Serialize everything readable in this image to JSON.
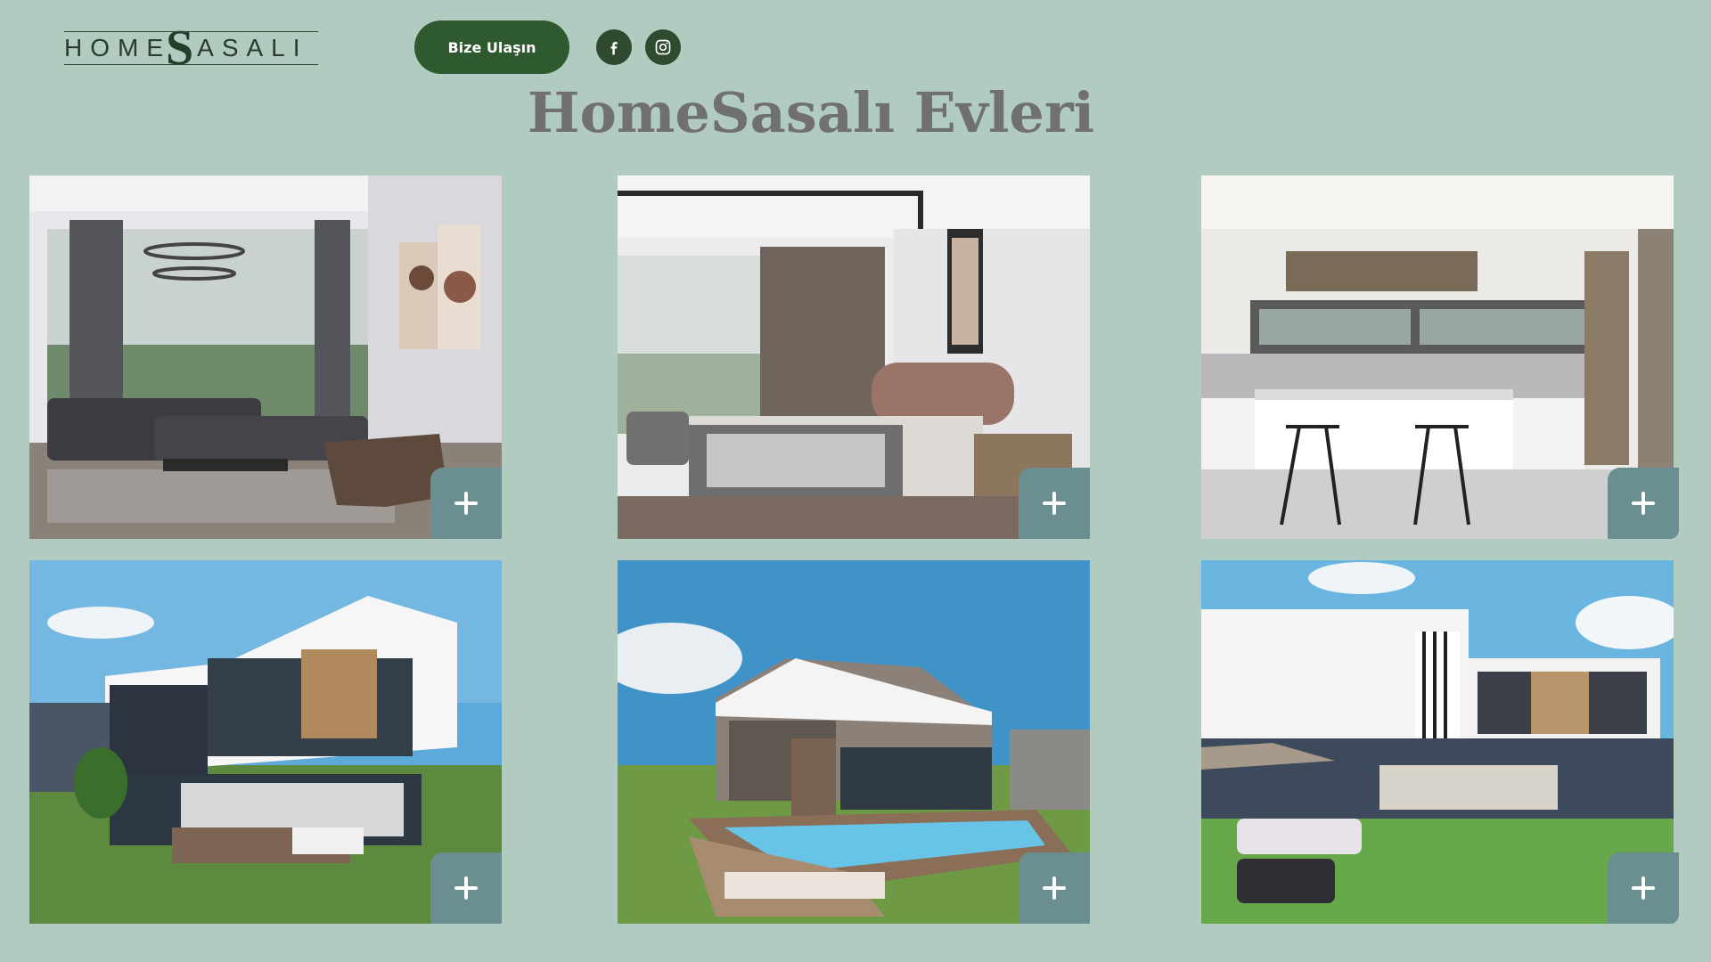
{
  "header": {
    "logo_left": "HOME",
    "logo_mark": "S",
    "logo_right": "ASALI",
    "contact_button": "Bize Ulaşın",
    "social": [
      {
        "name": "facebook-icon"
      },
      {
        "name": "instagram-icon"
      }
    ]
  },
  "page": {
    "title": "HomeSasalı Evleri"
  },
  "gallery": {
    "items": [
      {
        "scene": "living-room"
      },
      {
        "scene": "bedroom"
      },
      {
        "scene": "kitchen"
      },
      {
        "scene": "villa-front"
      },
      {
        "scene": "villa-pool"
      },
      {
        "scene": "villa-garden"
      }
    ],
    "expand_icon": "plus-icon"
  },
  "colors": {
    "background": "#b2cbc0",
    "button": "#2f5a2f",
    "title": "#707070",
    "expand_button": "#6b8f91"
  }
}
